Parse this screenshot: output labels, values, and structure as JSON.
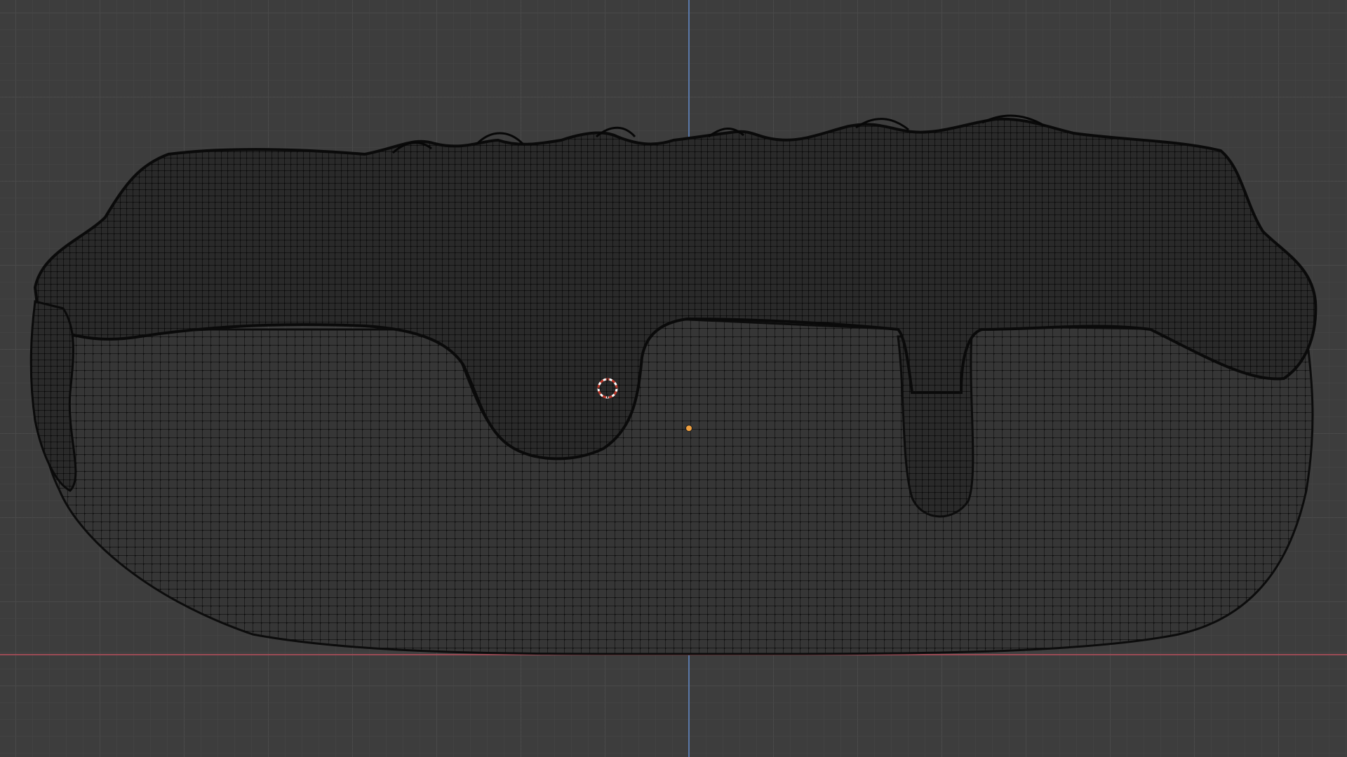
{
  "app": {
    "view": "3d-viewport"
  },
  "viewport": {
    "background_color": "#3d3d3d",
    "grid_color": "#505050",
    "axis_x_color": "#9b4b55",
    "axis_y_color": "#5a78a8",
    "mesh_color": "#151515",
    "mesh_vertex_color": "#0c0c0c"
  },
  "scene": {
    "object": "mesh-pillow-with-drips",
    "cursor_icon": "3d-cursor-icon",
    "origin_icon": "object-origin-icon",
    "origin_color": "#f0a040",
    "cursor_colors": [
      "#ffffff",
      "#c0392b"
    ]
  }
}
